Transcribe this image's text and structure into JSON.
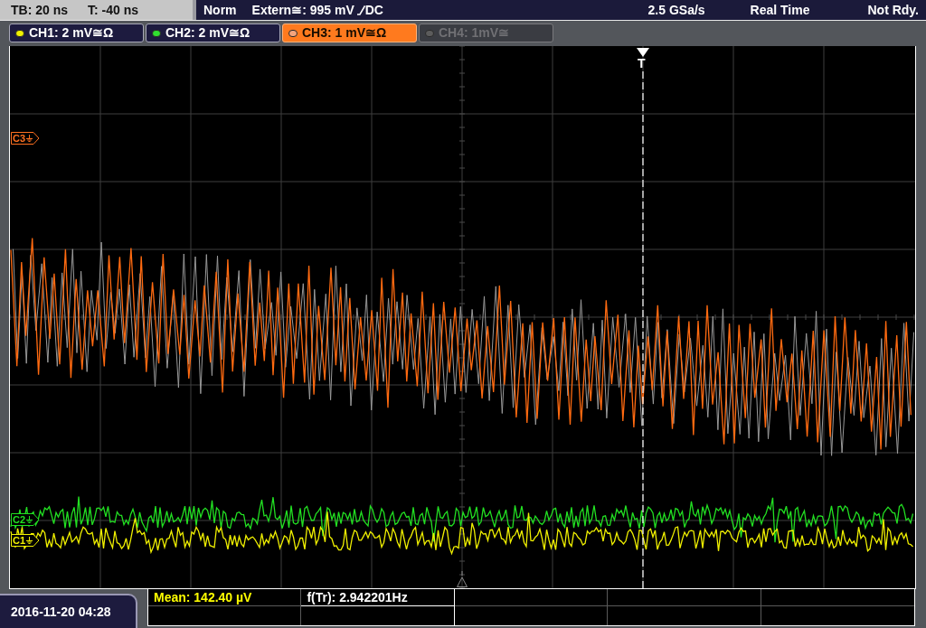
{
  "status_bar": {
    "timebase": "TB: 20 ns",
    "trigger_time": "T: -40 ns",
    "trigger_mode": "Norm",
    "trigger_source": "Extern≅: 995 mV",
    "coupling": "DC",
    "sample_rate": "2.5 GSa/s",
    "acquisition_mode": "Real Time",
    "state": "Not Rdy."
  },
  "channels": [
    {
      "label": "CH1: 2 mV≅Ω",
      "color": "#f0f000",
      "selected": false,
      "enabled": true
    },
    {
      "label": "CH2: 2 mV≅Ω",
      "color": "#30e030",
      "selected": false,
      "enabled": true
    },
    {
      "label": "CH3: 1 mV≅Ω",
      "color": "#f4a47c",
      "selected": true,
      "enabled": true
    },
    {
      "label": "CH4: 1mV≅",
      "color": "#5c5c5c",
      "selected": false,
      "enabled": false
    }
  ],
  "display": {
    "trigger_label": "T",
    "markers": [
      {
        "label": "C3",
        "color": "#ff7020"
      },
      {
        "label": "C2",
        "color": "#20e020"
      },
      {
        "label": "C1",
        "color": "#f0f000"
      }
    ]
  },
  "date_time": "2016-11-20 04:28",
  "measurements": [
    {
      "text": "Mean: 142.40 µV",
      "color": "#ffff00"
    },
    {
      "text": "f(Tr): 2.942201Hz",
      "color": "#ffffff"
    }
  ]
}
